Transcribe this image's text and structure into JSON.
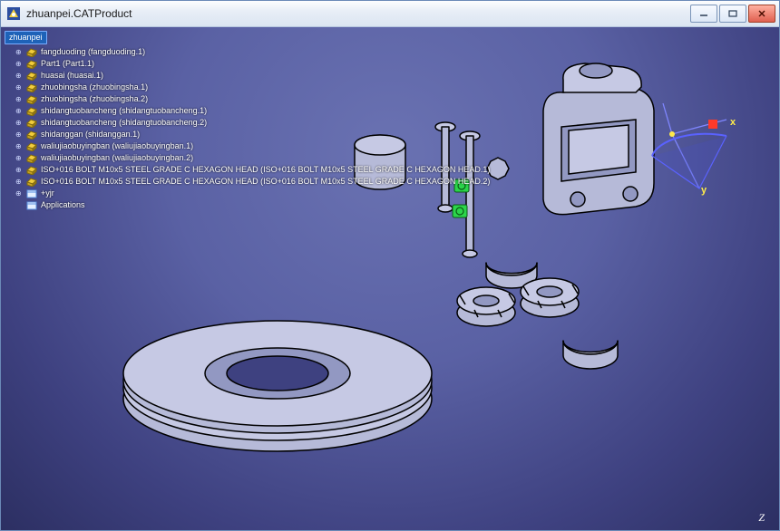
{
  "window": {
    "title": "zhuanpei.CATProduct"
  },
  "tree": {
    "root": "zhuanpei",
    "items": [
      "fangduoding (fangduoding.1)",
      "Part1 (Part1.1)",
      "huasai (huasai.1)",
      "zhuobingsha (zhuobingsha.1)",
      "zhuobingsha (zhuobingsha.2)",
      "shidangtuobancheng (shidangtuobancheng.1)",
      "shidangtuobancheng (shidangtuobancheng.2)",
      "shidanggan (shidanggan.1)",
      "waliujiaobuyingban (waliujiaobuyingban.1)",
      "waliujiaobuyingban (waliujiaobuyingban.2)",
      "ISO+016 BOLT M10x5 STEEL GRADE C HEXAGON HEAD (ISO+016 BOLT M10x5 STEEL GRADE C HEXAGON HEAD.1)",
      "ISO+016 BOLT M10x5 STEEL GRADE C HEXAGON HEAD (ISO+016 BOLT M10x5 STEEL GRADE C HEXAGON HEAD.2)",
      "+yjr",
      "Applications"
    ]
  },
  "compass": {
    "x": "x",
    "y": "y",
    "z": "Z"
  }
}
